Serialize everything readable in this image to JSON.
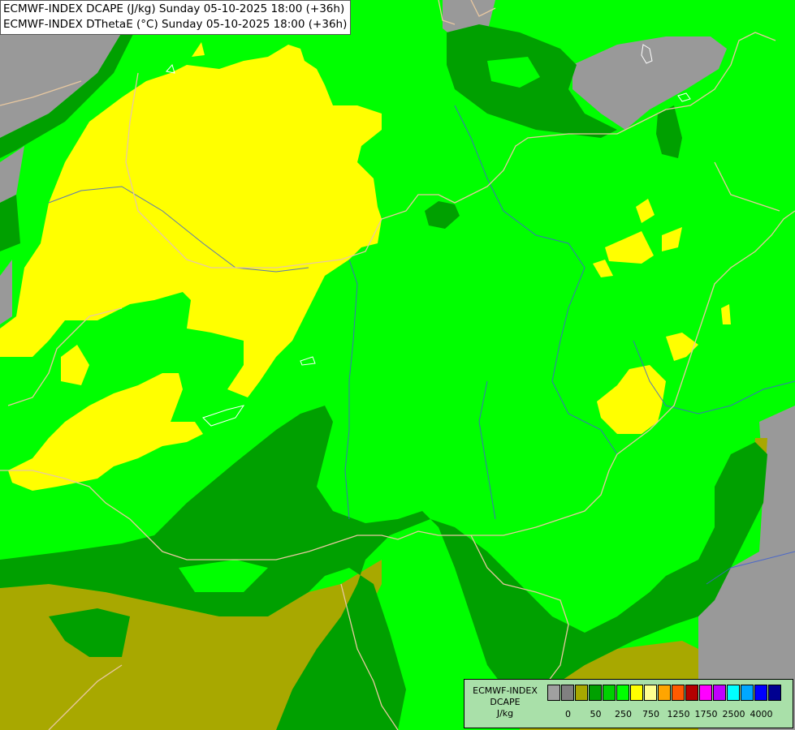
{
  "header": {
    "line1": "ECMWF-INDEX DCAPE (J/kg) Sunday 05-10-2025 18:00 (+36h)",
    "line2": "ECMWF-INDEX DThetaE (°C) Sunday 05-10-2025 18:00 (+36h)"
  },
  "legend": {
    "title1": "ECMWF-INDEX",
    "title2": "DCAPE",
    "unit": "J/kg",
    "colors": [
      "#a0a0a0",
      "#808080",
      "#a8a800",
      "#00a000",
      "#00d000",
      "#00ff00",
      "#ffff00",
      "#ffff90",
      "#ffa500",
      "#ff5a00",
      "#b40000",
      "#ff00ff",
      "#c000ff",
      "#00ffff",
      "#00a8ff",
      "#0000ff",
      "#000090"
    ],
    "ticks": [
      "0",
      "50",
      "250",
      "750",
      "1250",
      "1750",
      "2500",
      "4000"
    ]
  },
  "map": {
    "colors": {
      "gray": "#999999",
      "olive": "#a8a800",
      "dark_green": "#00a000",
      "mid_green": "#00d000",
      "bright_green": "#00ff00",
      "yellow": "#ffff00",
      "border": "#e8c8a0",
      "river": "#4060d0"
    }
  }
}
